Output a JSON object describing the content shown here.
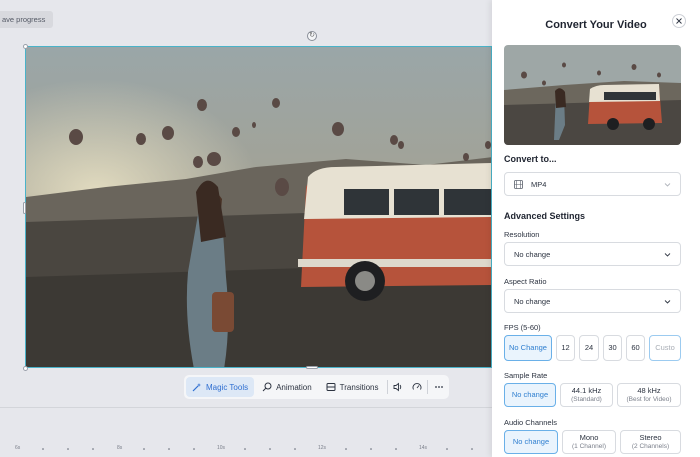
{
  "editor": {
    "save_progress": "ave progress",
    "toolbar": {
      "magic_tools": "Magic Tools",
      "animation": "Animation",
      "transitions": "Transitions"
    },
    "timeline": {
      "ticks": [
        "6s",
        "8s",
        "10s",
        "12s",
        "14s"
      ]
    }
  },
  "panel": {
    "title": "Convert Your Video",
    "convert_to": {
      "label": "Convert to...",
      "value": "MP4"
    },
    "advanced": {
      "title": "Advanced Settings",
      "resolution": {
        "label": "Resolution",
        "value": "No change"
      },
      "aspect_ratio": {
        "label": "Aspect Ratio",
        "value": "No change"
      },
      "fps": {
        "label": "FPS (5-60)",
        "options": [
          "No Change",
          "12",
          "24",
          "30",
          "60"
        ],
        "custom_placeholder": "Custo"
      },
      "sample_rate": {
        "label": "Sample Rate",
        "options": [
          {
            "main": "No change",
            "sub": ""
          },
          {
            "main": "44.1 kHz",
            "sub": "(Standard)"
          },
          {
            "main": "48 kHz",
            "sub": "(Best for Video)"
          }
        ]
      },
      "audio_channels": {
        "label": "Audio Channels",
        "options": [
          {
            "main": "No change",
            "sub": ""
          },
          {
            "main": "Mono",
            "sub": "(1 Channel)"
          },
          {
            "main": "Stereo",
            "sub": "(2 Channels)"
          }
        ]
      }
    }
  },
  "colors": {
    "accent": "#2f7fd0",
    "selection": "#4ab3c9"
  },
  "icons": {
    "close": "close-icon",
    "chevron": "chevron-down-icon",
    "film": "film-icon",
    "magic": "magic-wand-icon",
    "animation": "animation-icon",
    "transitions": "transitions-icon",
    "audio": "volume-icon",
    "speed": "speed-icon",
    "more": "more-icon"
  }
}
